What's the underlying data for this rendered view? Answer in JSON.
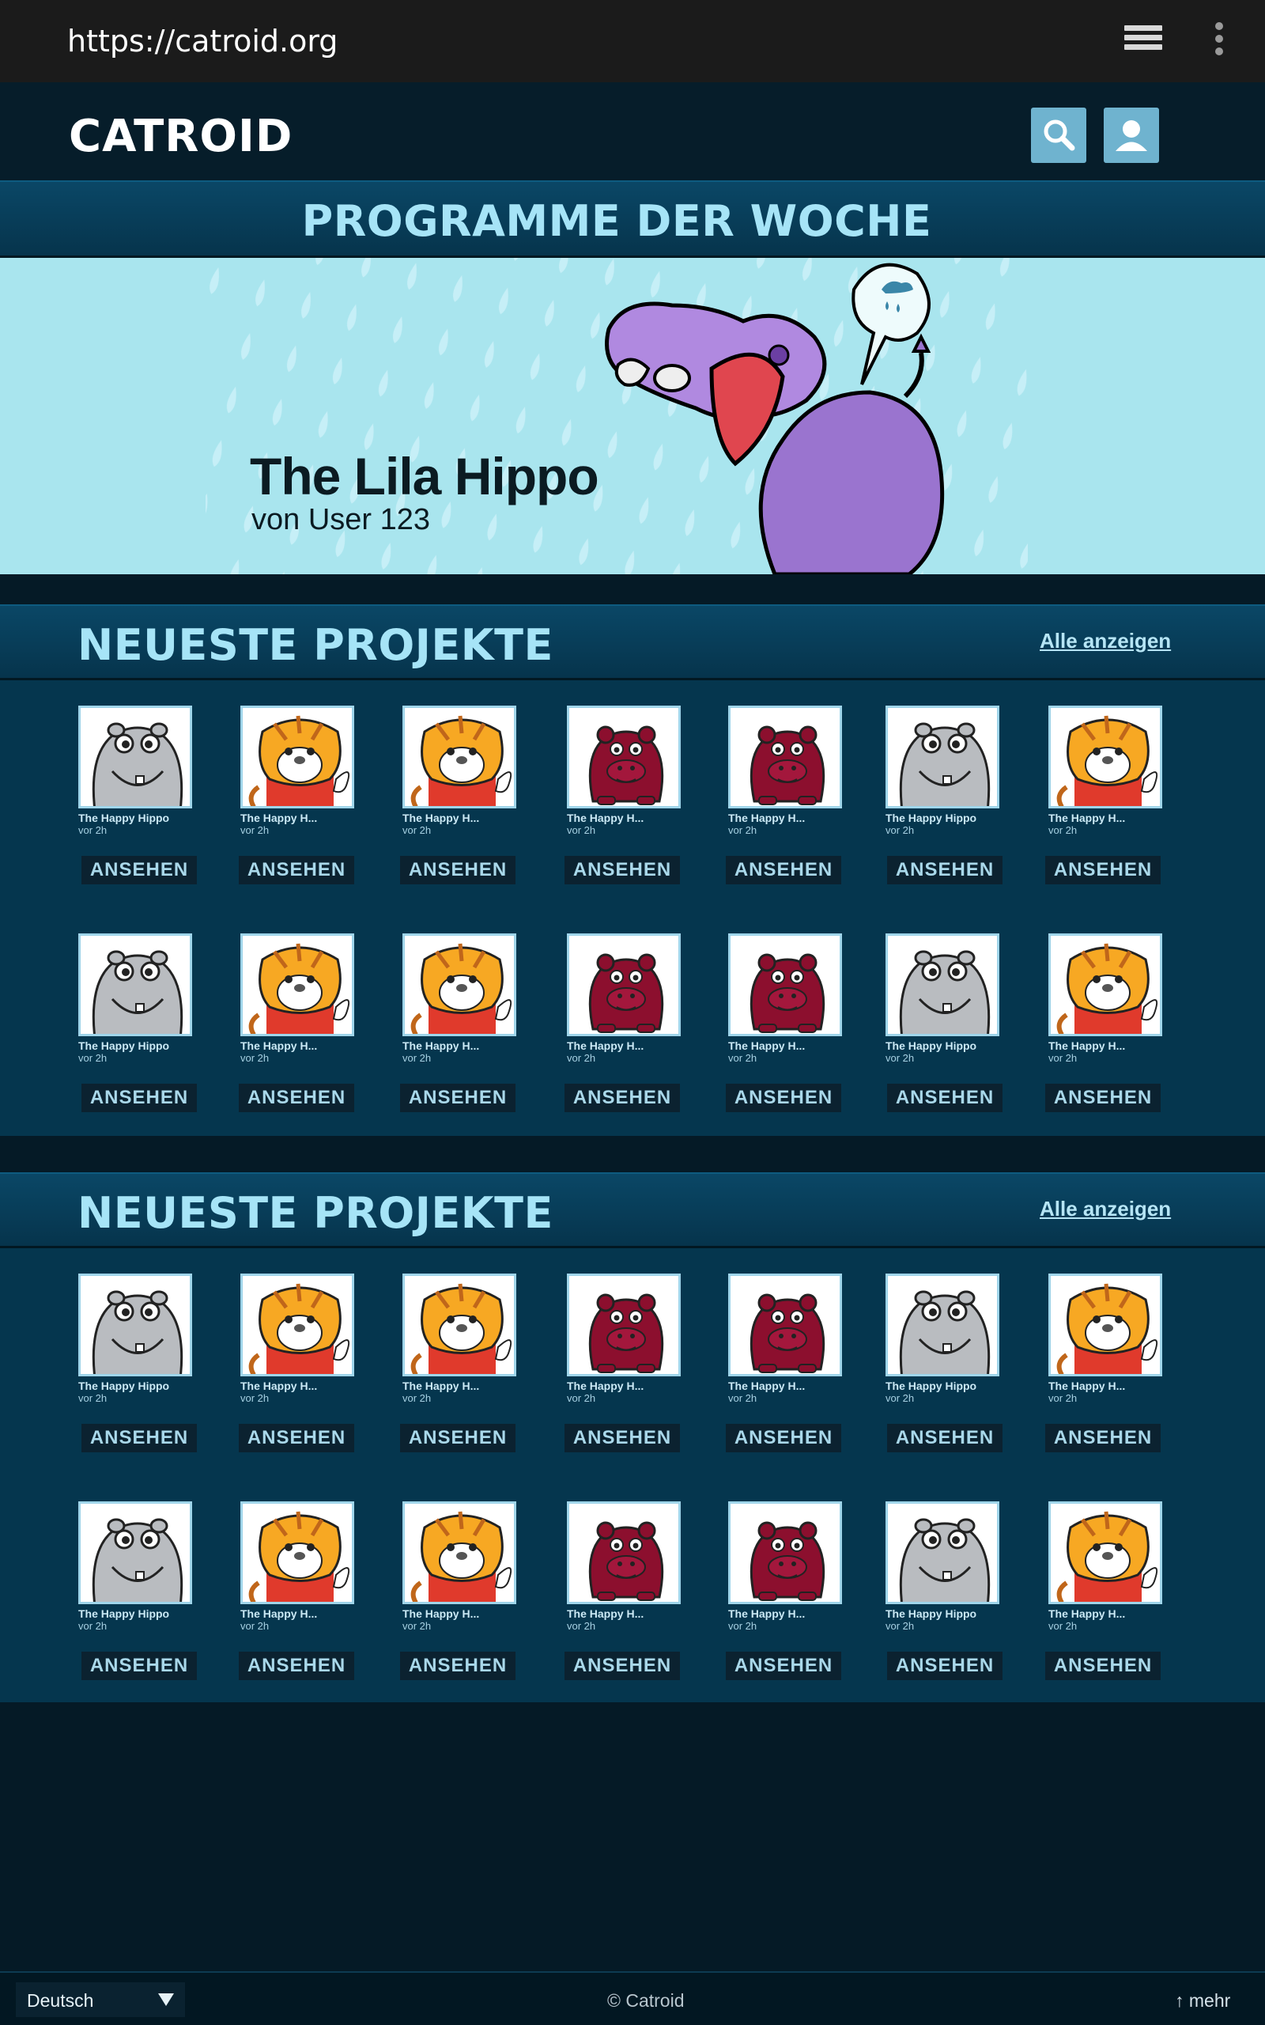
{
  "browser": {
    "url": "https://catroid.org",
    "tabs_icon": "tabs-icon",
    "menu_icon": "kebab-menu-icon"
  },
  "header": {
    "logo": "CATROID",
    "search_icon": "search-icon",
    "user_icon": "user-icon"
  },
  "featured": {
    "section_title": "PROGRAMME DER WOCHE",
    "title": "The Lila Hippo",
    "author": "von User 123"
  },
  "sections": [
    {
      "title": "NEUESTE PROJEKTE",
      "link": "Alle anzeigen",
      "rows": [
        [
          {
            "name": "The Happy Hippo",
            "time": "vor 2h",
            "button": "ANSEHEN",
            "art": "gray-hippo"
          },
          {
            "name": "The Happy H...",
            "time": "vor 2h",
            "button": "ANSEHEN",
            "art": "tiger"
          },
          {
            "name": "The Happy H...",
            "time": "vor 2h",
            "button": "ANSEHEN",
            "art": "tiger"
          },
          {
            "name": "The Happy H...",
            "time": "vor 2h",
            "button": "ANSEHEN",
            "art": "red-hippo"
          },
          {
            "name": "The Happy H...",
            "time": "vor 2h",
            "button": "ANSEHEN",
            "art": "red-hippo"
          },
          {
            "name": "The Happy Hippo",
            "time": "vor 2h",
            "button": "ANSEHEN",
            "art": "gray-hippo"
          },
          {
            "name": "The Happy H...",
            "time": "vor 2h",
            "button": "ANSEHEN",
            "art": "tiger"
          }
        ],
        [
          {
            "name": "The Happy Hippo",
            "time": "vor 2h",
            "button": "ANSEHEN",
            "art": "gray-hippo"
          },
          {
            "name": "The Happy H...",
            "time": "vor 2h",
            "button": "ANSEHEN",
            "art": "tiger"
          },
          {
            "name": "The Happy H...",
            "time": "vor 2h",
            "button": "ANSEHEN",
            "art": "tiger"
          },
          {
            "name": "The Happy H...",
            "time": "vor 2h",
            "button": "ANSEHEN",
            "art": "red-hippo"
          },
          {
            "name": "The Happy H...",
            "time": "vor 2h",
            "button": "ANSEHEN",
            "art": "red-hippo"
          },
          {
            "name": "The Happy Hippo",
            "time": "vor 2h",
            "button": "ANSEHEN",
            "art": "gray-hippo"
          },
          {
            "name": "The Happy H...",
            "time": "vor 2h",
            "button": "ANSEHEN",
            "art": "tiger"
          }
        ]
      ]
    },
    {
      "title": "NEUESTE PROJEKTE",
      "link": "Alle anzeigen",
      "rows": [
        [
          {
            "name": "The Happy Hippo",
            "time": "vor 2h",
            "button": "ANSEHEN",
            "art": "gray-hippo"
          },
          {
            "name": "The Happy H...",
            "time": "vor 2h",
            "button": "ANSEHEN",
            "art": "tiger"
          },
          {
            "name": "The Happy H...",
            "time": "vor 2h",
            "button": "ANSEHEN",
            "art": "tiger"
          },
          {
            "name": "The Happy H...",
            "time": "vor 2h",
            "button": "ANSEHEN",
            "art": "red-hippo"
          },
          {
            "name": "The Happy H...",
            "time": "vor 2h",
            "button": "ANSEHEN",
            "art": "red-hippo"
          },
          {
            "name": "The Happy Hippo",
            "time": "vor 2h",
            "button": "ANSEHEN",
            "art": "gray-hippo"
          },
          {
            "name": "The Happy H...",
            "time": "vor 2h",
            "button": "ANSEHEN",
            "art": "tiger"
          }
        ],
        [
          {
            "name": "The Happy Hippo",
            "time": "vor 2h",
            "button": "ANSEHEN",
            "art": "gray-hippo"
          },
          {
            "name": "The Happy H...",
            "time": "vor 2h",
            "button": "ANSEHEN",
            "art": "tiger"
          },
          {
            "name": "The Happy H...",
            "time": "vor 2h",
            "button": "ANSEHEN",
            "art": "tiger"
          },
          {
            "name": "The Happy H...",
            "time": "vor 2h",
            "button": "ANSEHEN",
            "art": "red-hippo"
          },
          {
            "name": "The Happy H...",
            "time": "vor 2h",
            "button": "ANSEHEN",
            "art": "red-hippo"
          },
          {
            "name": "The Happy Hippo",
            "time": "vor 2h",
            "button": "ANSEHEN",
            "art": "gray-hippo"
          },
          {
            "name": "The Happy H...",
            "time": "vor 2h",
            "button": "ANSEHEN",
            "art": "tiger"
          }
        ]
      ]
    }
  ],
  "footer": {
    "language": "Deutsch",
    "copyright": "© Catroid",
    "more": "↑ mehr"
  },
  "colors": {
    "page_bg": "#051a26",
    "section_bg": "#05364e",
    "banner_text": "#a6e4f7",
    "header_button": "#6fb3cf",
    "featured_bg": "#a9e5ee"
  }
}
